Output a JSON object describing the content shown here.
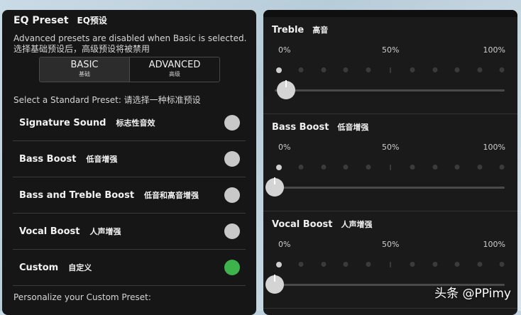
{
  "left_panel": {
    "title_en": "EQ Preset",
    "title_zh": "EQ预设",
    "note_en": "Advanced presets are disabled when Basic is selected.",
    "note_zh": "选择基础预设后，高级预设将被禁用",
    "segment": {
      "basic_label": "BASIC",
      "basic_sub": "基础",
      "advanced_label": "ADVANCED",
      "advanced_sub": "高级",
      "selected": "BASIC"
    },
    "select_label": "Select a Standard Preset:  请选择一种标准预设",
    "presets": [
      {
        "en": "Signature Sound",
        "zh": "标志性音效",
        "selected": false
      },
      {
        "en": "Bass Boost",
        "zh": "低音增强",
        "selected": false
      },
      {
        "en": "Bass and Treble Boost",
        "zh": "低音和高音增强",
        "selected": false
      },
      {
        "en": "Vocal Boost",
        "zh": "人声增强",
        "selected": false
      },
      {
        "en": "Custom",
        "zh": "自定义",
        "selected": true
      }
    ],
    "personalize_label": "Personalize your Custom Preset:"
  },
  "right_panel": {
    "scale_labels": [
      "0%",
      "50%",
      "100%"
    ],
    "sliders": [
      {
        "en": "Treble",
        "zh": "高音",
        "value_percent": 5
      },
      {
        "en": "Bass Boost",
        "zh": "低音增强",
        "value_percent": 0
      },
      {
        "en": "Vocal Boost",
        "zh": "人声增强",
        "value_percent": 0
      }
    ]
  },
  "watermark": "头条 @PPimy",
  "colors": {
    "selected_radio": "#3cb44b",
    "unselected_radio": "#c8c8c8",
    "panel_bg": "#161616"
  }
}
